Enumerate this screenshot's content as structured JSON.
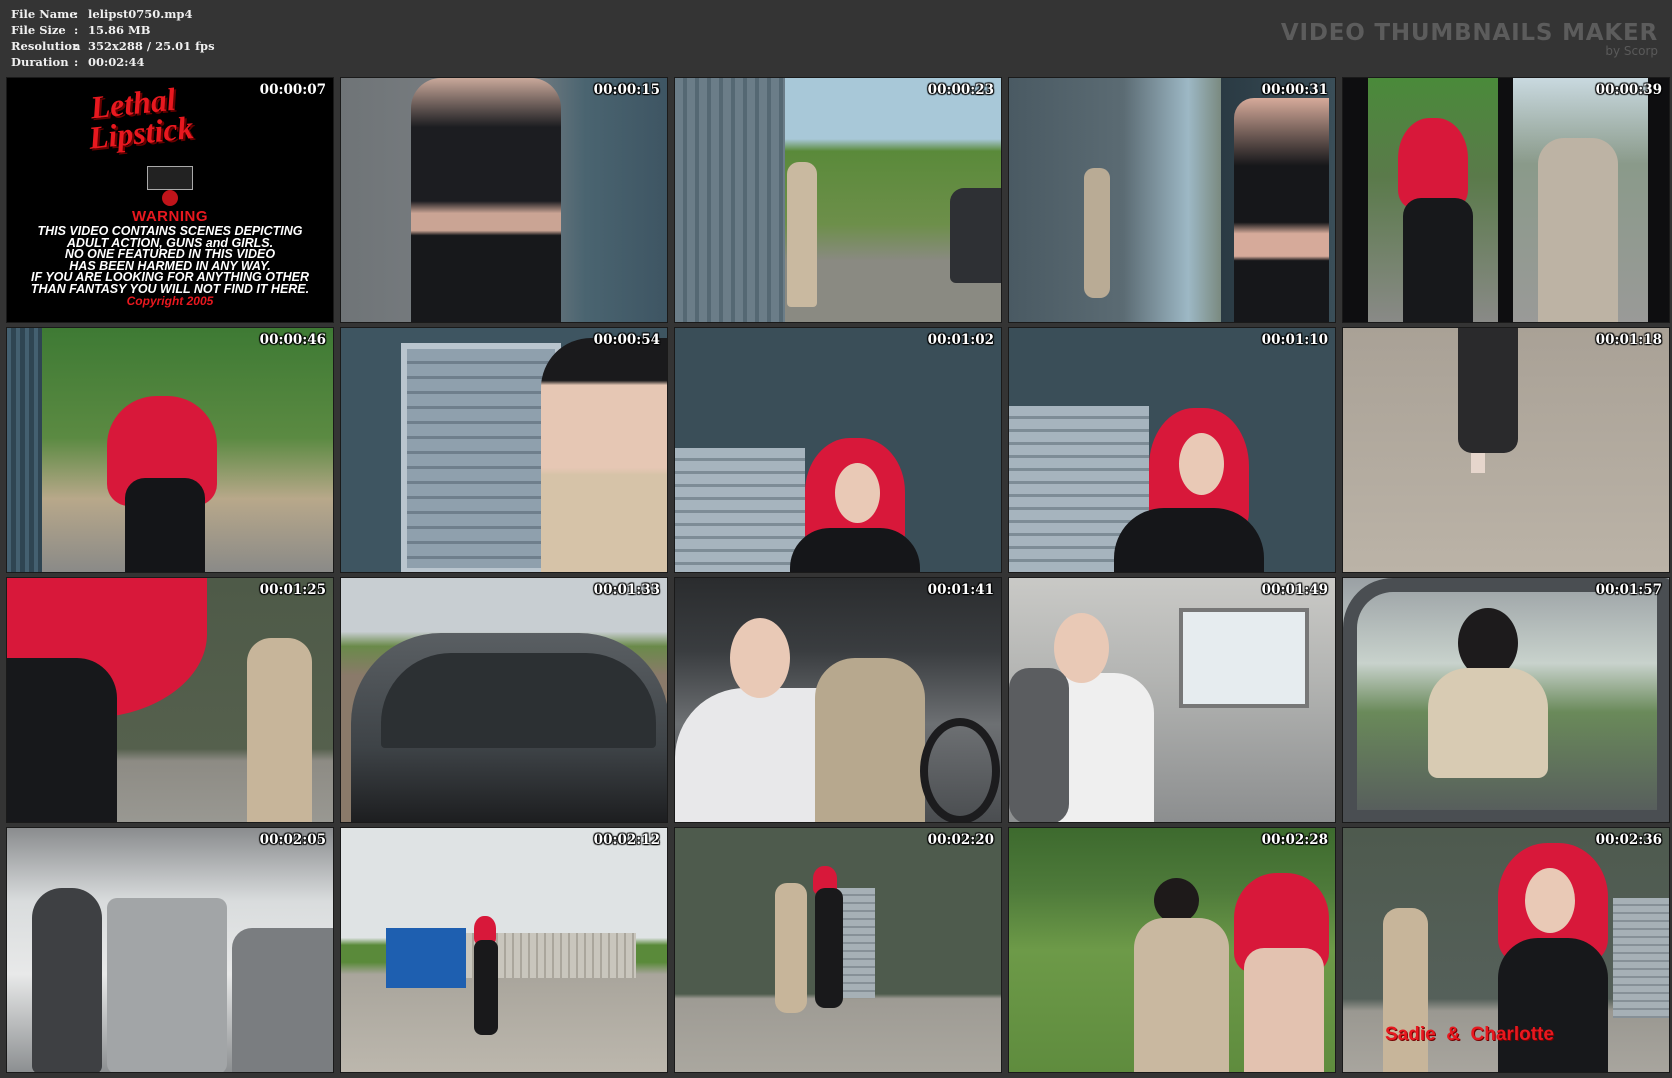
{
  "file_info": {
    "file_name_label": "File Name",
    "file_name_value": "lelipst0750.mp4",
    "file_size_label": "File Size",
    "file_size_value": "15.86 MB",
    "resolution_label": "Resolution",
    "resolution_value": "352x288 / 25.01 fps",
    "duration_label": "Duration",
    "duration_value": "00:02:44",
    "separator": ":"
  },
  "brand": {
    "title": "VIDEO THUMBNAILS MAKER",
    "subtitle": "by Scorp"
  },
  "warning_card": {
    "logo_line1": "Lethal",
    "logo_line2": "Lipstick",
    "title": "WARNING",
    "line1": "THIS VIDEO CONTAINS SCENES DEPICTING",
    "line2": "ADULT ACTION, GUNS and GIRLS.",
    "line3": "NO ONE FEATURED IN THIS VIDEO",
    "line4": "HAS BEEN HARMED IN ANY WAY.",
    "line5": "IF YOU ARE LOOKING FOR ANYTHING OTHER",
    "line6": "THAN FANTASY YOU WILL NOT FIND IT HERE.",
    "copyright": "Copyright 2005"
  },
  "last_caption": "Sadie  &  Charlotte",
  "thumbnails": [
    {
      "time": "00:00:07"
    },
    {
      "time": "00:00:15"
    },
    {
      "time": "00:00:23"
    },
    {
      "time": "00:00:31"
    },
    {
      "time": "00:00:39"
    },
    {
      "time": "00:00:46"
    },
    {
      "time": "00:00:54"
    },
    {
      "time": "00:01:02"
    },
    {
      "time": "00:01:10"
    },
    {
      "time": "00:01:18"
    },
    {
      "time": "00:01:25"
    },
    {
      "time": "00:01:33"
    },
    {
      "time": "00:01:41"
    },
    {
      "time": "00:01:49"
    },
    {
      "time": "00:01:57"
    },
    {
      "time": "00:02:05"
    },
    {
      "time": "00:02:12"
    },
    {
      "time": "00:02:20"
    },
    {
      "time": "00:02:28"
    },
    {
      "time": "00:02:36"
    }
  ]
}
